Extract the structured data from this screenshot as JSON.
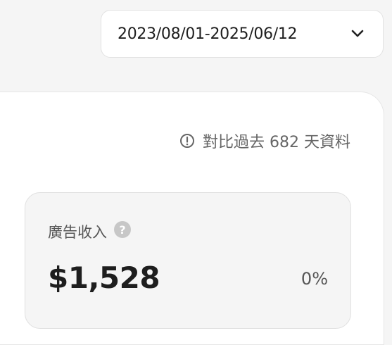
{
  "date_picker": {
    "range": "2023/08/01-2025/06/12",
    "icon": "chevron-down-icon"
  },
  "comparison": {
    "icon": "info-icon",
    "note": "對比過去 682 天資料"
  },
  "metric": {
    "label": "廣告收入",
    "help_icon": "question-mark-icon",
    "help_glyph": "?",
    "value": "$1,528",
    "change": "0%"
  },
  "colors": {
    "background": "#f5f5f5",
    "card": "#ffffff",
    "muted_text": "#666666",
    "help_icon": "#c7c7c7"
  }
}
